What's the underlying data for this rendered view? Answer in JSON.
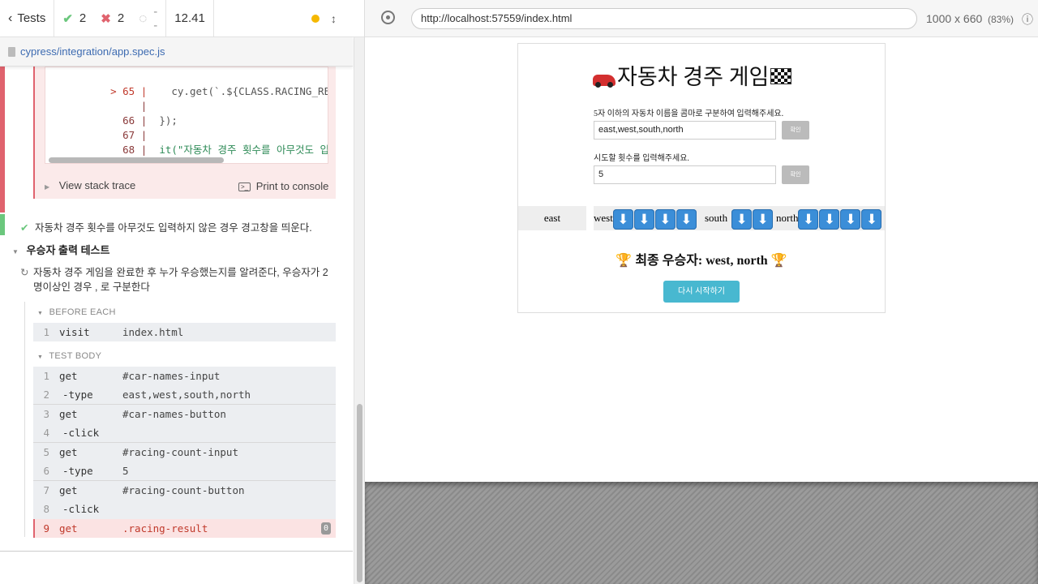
{
  "stats": {
    "back_label": "Tests",
    "passed": "2",
    "failed": "2",
    "pending": "--",
    "duration": "12.41"
  },
  "spec": {
    "path": "cypress/integration/app.spec.js"
  },
  "code": {
    "line65_num": "> 65 |",
    "line65_code": "    cy.get(`.${CLASS.RACING_RESULT}`)",
    "line65b_num": "|",
    "line66_num": "66 |",
    "line66_code": "  });",
    "line67_num": "67 |",
    "line68_num": "68 |",
    "line68_code": "  it(\"자동차 경주 횟수를 아무것도 입력하지 않은"
  },
  "error": {
    "stack_trace_label": "View stack trace",
    "print_label": "Print to console"
  },
  "tests": {
    "passed_test_title": "자동차 경주 횟수를 아무것도 입력하지 않은 경우 경고창을 띄운다.",
    "suite_title": "우승자 출력 테스트",
    "running_test_title_1": "자동차 경주 게임을 완료한 후 누가 우승했는지를 알려준다, 우승자가 2",
    "running_test_title_2": "명이상인 경우 , 로 구분한다"
  },
  "before_each": {
    "header": "BEFORE EACH",
    "commands": [
      {
        "num": "1",
        "name": "visit",
        "msg": "index.html"
      }
    ]
  },
  "test_body": {
    "header": "TEST BODY",
    "commands": [
      {
        "num": "1",
        "name": "get",
        "msg": "#car-names-input"
      },
      {
        "num": "2",
        "name": "-type",
        "msg": "east,west,south,north"
      },
      {
        "num": "3",
        "name": "get",
        "msg": "#car-names-button"
      },
      {
        "num": "4",
        "name": "-click",
        "msg": ""
      },
      {
        "num": "5",
        "name": "get",
        "msg": "#racing-count-input"
      },
      {
        "num": "6",
        "name": "-type",
        "msg": "5"
      },
      {
        "num": "7",
        "name": "get",
        "msg": "#racing-count-button"
      },
      {
        "num": "8",
        "name": "-click",
        "msg": ""
      },
      {
        "num": "9",
        "name": "get",
        "msg": ".racing-result",
        "badge": "0"
      }
    ]
  },
  "browser": {
    "url": "http://localhost:57559/index.html",
    "viewport": "1000 x 660",
    "scale": "(83%)"
  },
  "app": {
    "title": "자동차 경주 게임",
    "car_names_label": "5자 이하의 자동차 이름을 콤마로 구분하여 입력해주세요.",
    "car_names_value": "east,west,south,north",
    "confirm_label": "확인",
    "count_label": "시도할 횟수를 입력해주세요.",
    "count_value": "5",
    "cars": [
      {
        "name": "east",
        "moves": 0
      },
      {
        "name": "west",
        "moves": 4
      },
      {
        "name": "south",
        "moves": 2
      },
      {
        "name": "north",
        "moves": 4
      }
    ],
    "winner_text": "최종 우승자: west, north",
    "restart_label": "다시 시작하기"
  },
  "colors": {
    "fail": "#e0636e",
    "pass": "#6bc77d",
    "accent": "#3d6bb1",
    "restart": "#48b8d0"
  }
}
